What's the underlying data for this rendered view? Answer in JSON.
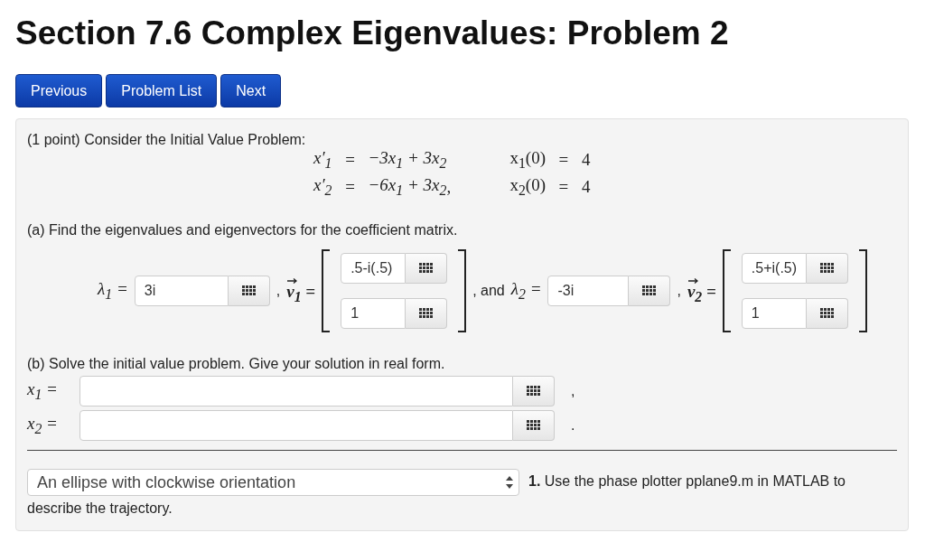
{
  "title": "Section 7.6 Complex Eigenvalues: Problem 2",
  "nav_buttons": [
    "Previous",
    "Problem List",
    "Next"
  ],
  "intro": "(1 point) Consider the Initial Value Problem:",
  "system": [
    {
      "lhs": "x′$_{1}$",
      "eq": "=",
      "rhs": "−3x$_{1}$ + 3x$_{2}$",
      "ic_lhs": "x$_{1}$(0)",
      "ic_eq": "=",
      "ic_value": "4"
    },
    {
      "lhs": "x′$_{2}$",
      "eq": "=",
      "rhs": "−6x$_{1}$ + 3x$_{2}$",
      "punct": ",",
      "ic_lhs": "x$_{2}$(0)",
      "ic_eq": "=",
      "ic_value": "4"
    }
  ],
  "part_a": {
    "prompt": "(a) Find the eigenvalues and eigenvectors for the coefficient matrix.",
    "pairs": [
      {
        "lambda_label": "λ$_{1}$ =",
        "lambda_value": "3i",
        "vector_lead": ",",
        "vector_label": "v$_{1}$ =",
        "vector_values": [
          ".5-i(.5)",
          "1"
        ]
      },
      {
        "lead": ", and",
        "lambda_label": "λ$_{2}$ =",
        "lambda_value": "-3i",
        "vector_lead": ",",
        "vector_label": "v$_{2}$ =",
        "vector_values": [
          ".5+i(.5)",
          "1"
        ]
      }
    ]
  },
  "part_b": {
    "prompt": "(b) Solve the initial value problem. Give your solution in real form.",
    "rows": [
      {
        "label": "x$_{1}$ =",
        "punct": ","
      },
      {
        "label": "x$_{2}$ =",
        "punct": "."
      }
    ]
  },
  "part_c": {
    "selected_option": "An ellipse with clockwise orientation",
    "text_lines": [
      "**1.** Use the phase plotter pplane9.m in MATLAB to",
      "describe the trajectory."
    ]
  }
}
